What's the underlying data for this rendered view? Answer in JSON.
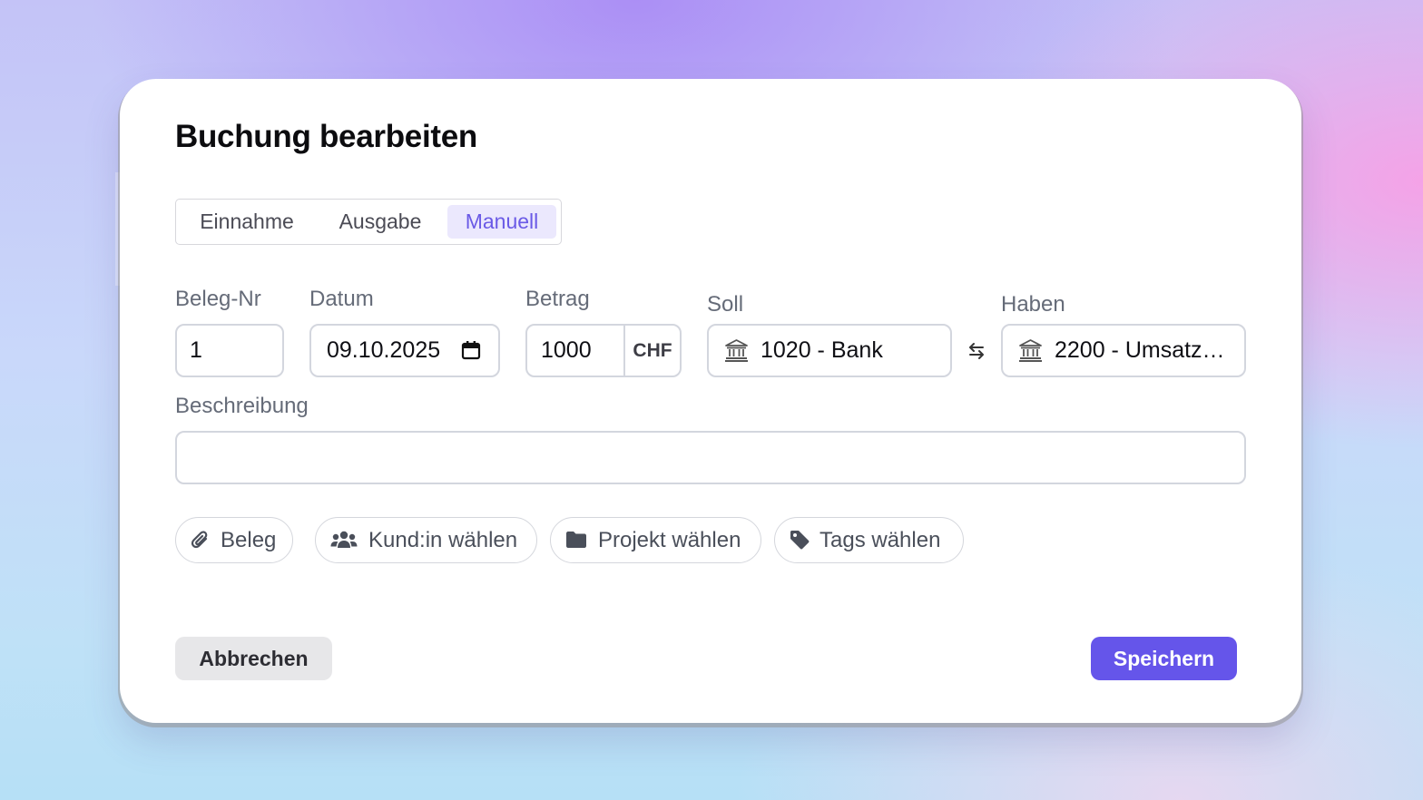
{
  "dialog": {
    "title": "Buchung bearbeiten"
  },
  "tabs": {
    "items": [
      "Einnahme",
      "Ausgabe",
      "Manuell"
    ],
    "selected": "Manuell"
  },
  "form": {
    "beleg_nr": {
      "label": "Beleg-Nr",
      "value": "1"
    },
    "datum": {
      "label": "Datum",
      "value": "09.10.2025",
      "icon": "calendar-icon"
    },
    "betrag": {
      "label": "Betrag",
      "value": "1000",
      "currency": "CHF"
    },
    "soll": {
      "label": "Soll",
      "value": "1020 - Bank",
      "icon": "bank-icon"
    },
    "haben": {
      "label": "Haben",
      "value": "2200 - Umsatz…",
      "icon": "bank-icon"
    },
    "swap_icon": "swap-arrows-icon",
    "beschreibung": {
      "label": "Beschreibung",
      "value": "",
      "placeholder": ""
    }
  },
  "chips": {
    "beleg": {
      "label": "Beleg",
      "icon": "paperclip-icon"
    },
    "kunde": {
      "label": "Kund:in wählen",
      "icon": "users-icon"
    },
    "projekt": {
      "label": "Projekt wählen",
      "icon": "folder-icon"
    },
    "tags": {
      "label": "Tags wählen",
      "icon": "tag-icon"
    }
  },
  "actions": {
    "cancel_label": "Abbrechen",
    "save_label": "Speichern"
  },
  "colors": {
    "accent": "#6555ea",
    "accent_soft": "#ebe8fd",
    "cancel_bg": "#e7e7e9",
    "label": "#656b78",
    "border": "#d3d6de"
  }
}
